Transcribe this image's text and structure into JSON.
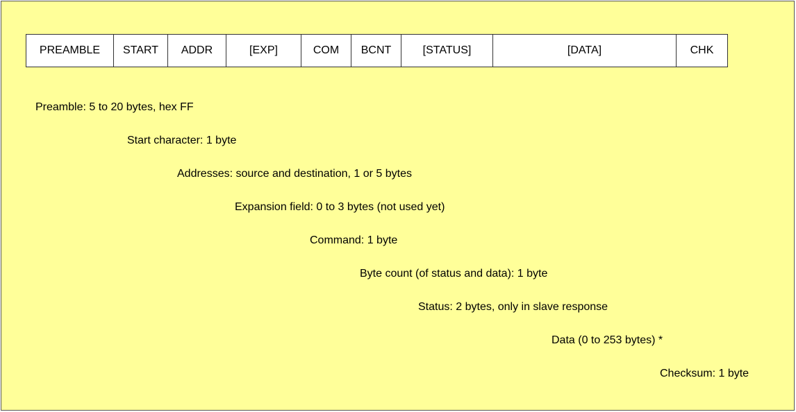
{
  "fields": [
    "PREAMBLE",
    "START",
    "ADDR",
    "[EXP]",
    "COM",
    "BCNT",
    "[STATUS]",
    "[DATA]",
    "CHK"
  ],
  "descriptions": [
    "Preamble: 5 to 20 bytes, hex FF",
    "Start character: 1 byte",
    "Addresses: source and destination, 1 or 5 bytes",
    "Expansion field: 0 to 3 bytes (not used yet)",
    "Command: 1 byte",
    "Byte count (of status and data): 1 byte",
    "Status: 2 bytes, only in slave response",
    "Data (0 to 253 bytes) *",
    "Checksum: 1 byte"
  ],
  "colors": {
    "background": "#ffff99",
    "cell": "#ffffff"
  }
}
